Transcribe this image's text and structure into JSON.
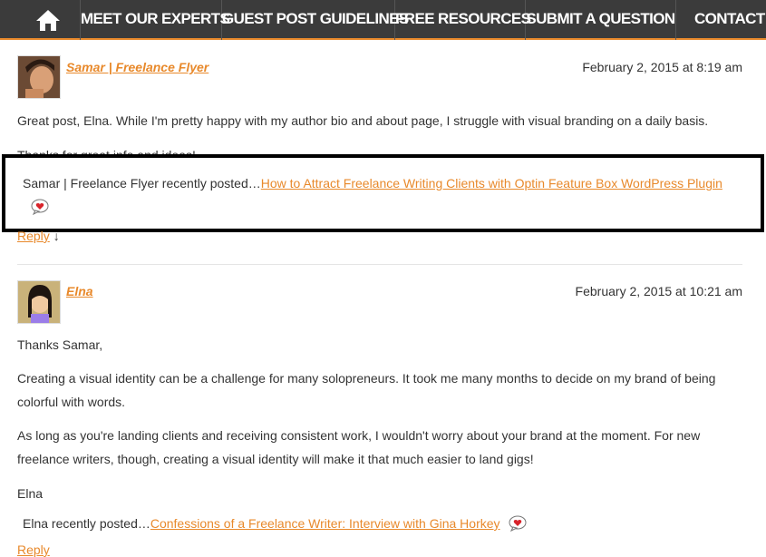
{
  "nav": {
    "items": [
      {
        "label": "MEET OUR EXPERTS"
      },
      {
        "label": "GUEST POST GUIDELINES"
      },
      {
        "label": "FREE RESOURCES"
      },
      {
        "label": "SUBMIT A QUESTION"
      },
      {
        "label": "CONTACT US"
      }
    ]
  },
  "comments": [
    {
      "author": "Samar | Freelance Flyer",
      "date": "February 2, 2015 at 8:19 am",
      "p1": "Great post, Elna. While I'm pretty happy with my author bio and about page, I struggle with visual branding on a daily basis.",
      "p2": "Thanks for great info and ideas!",
      "recent_prefix": "Samar | Freelance Flyer recently posted…",
      "recent_link": "How to Attract Freelance Writing Clients with Optin Feature Box WordPress Plugin",
      "reply": "Reply",
      "reply_arrow": "↓"
    },
    {
      "author": "Elna",
      "date": "February 2, 2015 at 10:21 am",
      "p1": "Thanks Samar,",
      "p2": "Creating a visual identity can be a challenge for many solopreneurs. It took me many months to decide on my brand of being colorful with words.",
      "p3": "As long as you're landing clients and receiving consistent work, I wouldn't worry about your brand at the moment. For new freelance writers, though, creating a visual identity will make it that much easier to land gigs!",
      "p4": "Elna",
      "recent_prefix": "Elna recently posted…",
      "recent_link": "Confessions of a Freelance Writer: Interview with Gina Horkey",
      "reply": "Reply"
    }
  ],
  "colors": {
    "accent": "#e8892b",
    "nav_bg": "#3b3b3b"
  }
}
